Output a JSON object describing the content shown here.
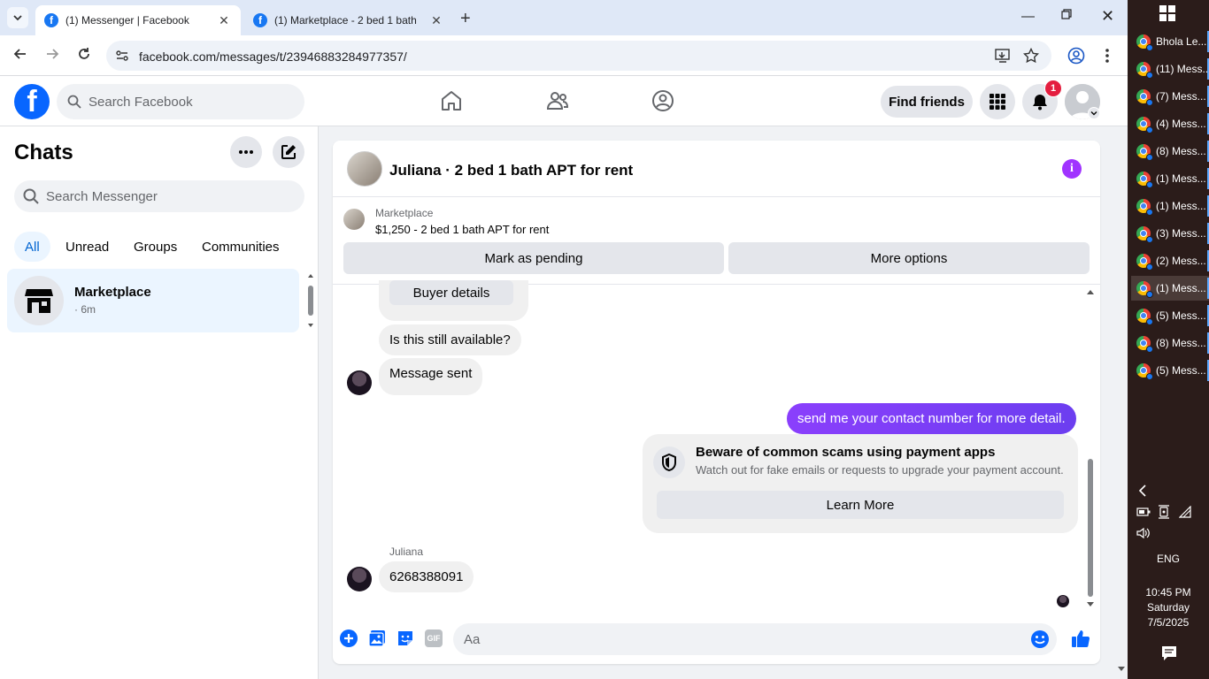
{
  "browser": {
    "tabs": [
      {
        "title": "(1) Messenger | Facebook",
        "active": true
      },
      {
        "title": "(1) Marketplace - 2 bed 1 bath",
        "active": false
      }
    ],
    "url": "facebook.com/messages/t/23946883284977357/"
  },
  "fb_header": {
    "search_placeholder": "Search Facebook",
    "find_friends_label": "Find friends",
    "notification_count": "1"
  },
  "sidebar": {
    "title": "Chats",
    "search_placeholder": "Search Messenger",
    "filters": [
      "All",
      "Unread",
      "Groups",
      "Communities"
    ],
    "active_filter": "All",
    "chats": [
      {
        "name": "Marketplace",
        "time": "· 6m"
      }
    ]
  },
  "conversation": {
    "title": "Juliana · 2 bed 1 bath APT for rent",
    "marketplace_label": "Marketplace",
    "listing": "$1,250 - 2 bed 1 bath APT for rent",
    "mark_pending_label": "Mark as pending",
    "more_options_label": "More options",
    "buyer_details_label": "Buyer details",
    "messages": [
      {
        "text": "Is this still available?",
        "direction": "in"
      },
      {
        "text": "Message sent",
        "direction": "in"
      },
      {
        "text": "send me your contact number for more detail.",
        "direction": "out"
      },
      {
        "text": "6268388091",
        "direction": "in",
        "sender": "Juliana"
      }
    ],
    "scam_warning": {
      "title": "Beware of common scams using payment apps",
      "text": "Watch out for fake emails or requests to upgrade your payment account.",
      "button": "Learn More"
    },
    "composer_placeholder": "Aa",
    "accent_color": "#7f3df2"
  },
  "taskbar": {
    "windows": [
      {
        "title": "Bhola Le...",
        "selected": false
      },
      {
        "title": "(11) Mess...",
        "selected": false
      },
      {
        "title": "(7) Mess...",
        "selected": false
      },
      {
        "title": "(4) Mess...",
        "selected": false
      },
      {
        "title": "(8) Mess...",
        "selected": false
      },
      {
        "title": "(1) Mess...",
        "selected": false
      },
      {
        "title": "(1) Mess...",
        "selected": false
      },
      {
        "title": "(3) Mess...",
        "selected": false
      },
      {
        "title": "(2) Mess...",
        "selected": false
      },
      {
        "title": "(1) Mess...",
        "selected": true
      },
      {
        "title": "(5) Mess...",
        "selected": false
      },
      {
        "title": "(8) Mess...",
        "selected": false
      },
      {
        "title": "(5) Mess...",
        "selected": false
      }
    ],
    "language": "ENG",
    "time": "10:45 PM",
    "day": "Saturday",
    "date": "7/5/2025"
  }
}
